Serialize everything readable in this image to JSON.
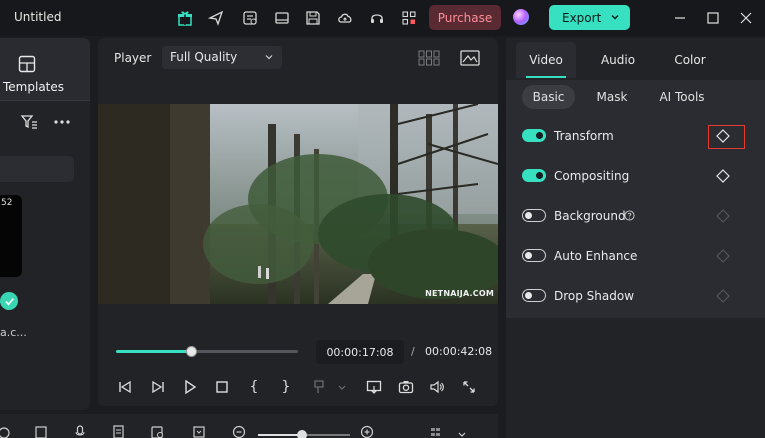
{
  "titlebar": {
    "title": "Untitled",
    "purchase_label": "Purchase",
    "export_label": "Export",
    "icons": [
      "gift-icon",
      "send-icon",
      "checklist-icon",
      "film-icon",
      "save-icon",
      "cloud-upload-icon",
      "headset-icon",
      "apps-grid-icon"
    ],
    "window_controls": [
      "minimize-icon",
      "maximize-icon",
      "close-icon"
    ]
  },
  "left_panel": {
    "tab_label": "Templates",
    "thumbnail_time": "52",
    "thumbnail_name": "a.c..."
  },
  "player": {
    "label": "Player",
    "quality": "Full Quality",
    "watermark": "NETNAIJA.COM",
    "current_time": "00:00:17:08",
    "separator": "/",
    "total_time": "00:00:42:08",
    "progress": 0.41,
    "controls": [
      "prev-frame-icon",
      "next-frame-icon",
      "play-icon",
      "stop-icon",
      "mark-in-icon",
      "mark-out-icon",
      "clip-icon",
      "display-icon",
      "snapshot-icon",
      "volume-icon",
      "fullscreen-icon"
    ],
    "mark_in": "{",
    "mark_out": "}"
  },
  "right_panel": {
    "tabs": [
      {
        "label": "Video",
        "active": true
      },
      {
        "label": "Audio",
        "active": false
      },
      {
        "label": "Color",
        "active": false
      }
    ],
    "sub_tabs": [
      {
        "label": "Basic",
        "active": true
      },
      {
        "label": "Mask",
        "active": false
      },
      {
        "label": "AI Tools",
        "active": false
      }
    ],
    "properties": [
      {
        "label": "Transform",
        "enabled": true
      },
      {
        "label": "Compositing",
        "enabled": true
      },
      {
        "label": "Background",
        "enabled": false
      },
      {
        "label": "Auto Enhance",
        "enabled": false
      },
      {
        "label": "Drop Shadow",
        "enabled": false
      }
    ]
  },
  "bottom_bar": {
    "zoom": 0.48
  },
  "colors": {
    "accent": "#36e0c0",
    "purchase_bg": "#5a2a33",
    "purchase_text": "#ff8d9a",
    "highlight_box": "#e53a30"
  }
}
